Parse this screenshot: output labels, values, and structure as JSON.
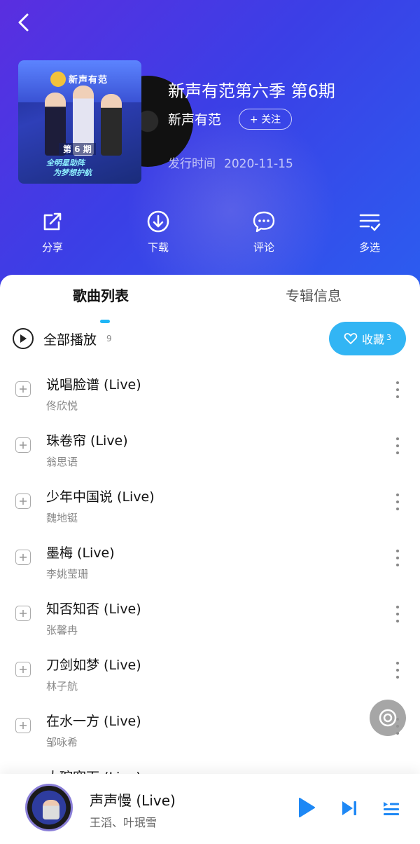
{
  "header": {
    "back_icon": "chevron-left-icon"
  },
  "album": {
    "cover_logo_text": "新声有范",
    "cover_episode_text": "第 6 期",
    "cover_slogan_line1": "全明星助阵",
    "cover_slogan_line2": "为梦想护航",
    "title": "新声有范第六季 第6期",
    "artist": "新声有范",
    "follow_label": "+ 关注",
    "release_label": "发行时间",
    "release_date": "2020-11-15"
  },
  "actions": [
    {
      "label": "分享",
      "icon": "share-icon"
    },
    {
      "label": "下载",
      "icon": "download-icon"
    },
    {
      "label": "评论",
      "icon": "comment-icon"
    },
    {
      "label": "多选",
      "icon": "multi-select-icon"
    }
  ],
  "tabs": {
    "songs": "歌曲列表",
    "info": "专辑信息",
    "active": "songs"
  },
  "playall": {
    "label": "全部播放",
    "count": "9",
    "collect_label": "收藏",
    "collect_count": "3"
  },
  "songs": [
    {
      "title": "说唱脸谱 (Live)",
      "artist": "佟欣悦"
    },
    {
      "title": "珠卷帘 (Live)",
      "artist": "翁思语"
    },
    {
      "title": "少年中国说 (Live)",
      "artist": "魏地铤"
    },
    {
      "title": "墨梅 (Live)",
      "artist": "李姚莹珊"
    },
    {
      "title": "知否知否 (Live)",
      "artist": "张馨冉"
    },
    {
      "title": "刀剑如梦 (Live)",
      "artist": "林子航"
    },
    {
      "title": "在水一方 (Live)",
      "artist": "邹咏希"
    },
    {
      "title": "大碗宽面 (Live)",
      "artist": ""
    }
  ],
  "player": {
    "title": "声声慢 (Live)",
    "artist": "王滔、叶珉雪"
  },
  "colors": {
    "hero_start": "#5a2ee0",
    "hero_end": "#2b5ef0",
    "accent": "#32b5f4",
    "play_blue": "#1e88f5"
  }
}
